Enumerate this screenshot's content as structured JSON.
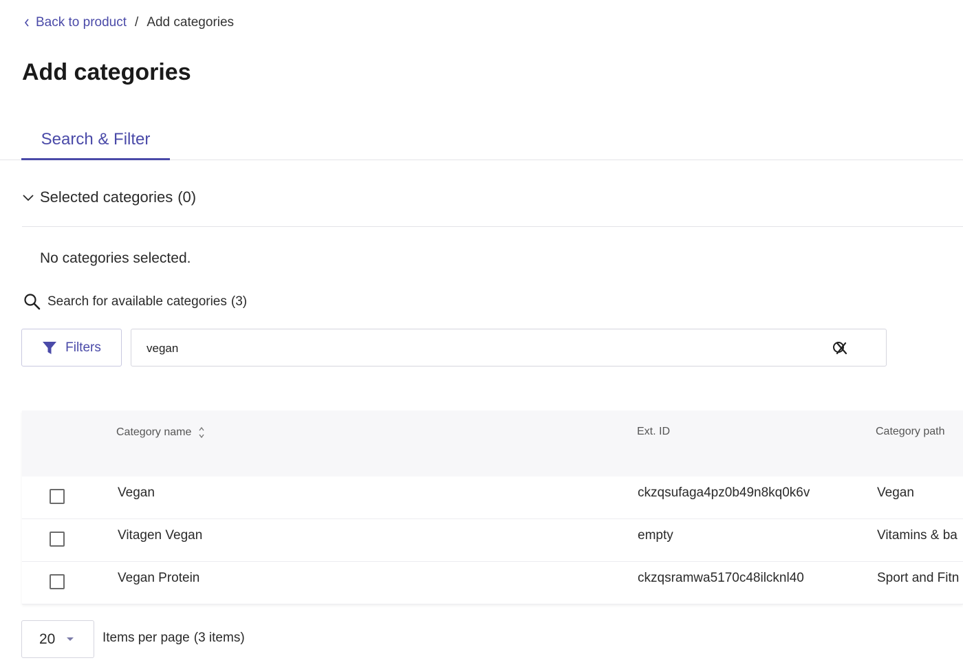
{
  "breadcrumb": {
    "back_label": "Back to product",
    "separator": "/",
    "current": "Add categories"
  },
  "page": {
    "title": "Add categories"
  },
  "tabs": [
    {
      "label": "Search & Filter",
      "active": true
    }
  ],
  "selected": {
    "label": "Selected categories",
    "count": "(0)",
    "empty_message": "No categories selected."
  },
  "search": {
    "label": "Search for available categories",
    "count": "(3)",
    "value": "vegan",
    "filters_label": "Filters"
  },
  "table": {
    "columns": [
      "Category name",
      "Ext. ID",
      "Category path"
    ],
    "rows": [
      {
        "name": "Vegan",
        "ext_id": "ckzqsufaga4pz0b49n8kq0k6v",
        "path": "Vegan"
      },
      {
        "name": "Vitagen Vegan",
        "ext_id": "empty",
        "path": "Vitamins & ba"
      },
      {
        "name": "Vegan Protein",
        "ext_id": "ckzqsramwa5170c48ilcknl40",
        "path": "Sport and Fitn"
      }
    ]
  },
  "pagination": {
    "per_page": "20",
    "label": "Items per page",
    "info": "(3 items)"
  },
  "colors": {
    "accent": "#4a4aa8",
    "border": "#e3e3e8"
  }
}
